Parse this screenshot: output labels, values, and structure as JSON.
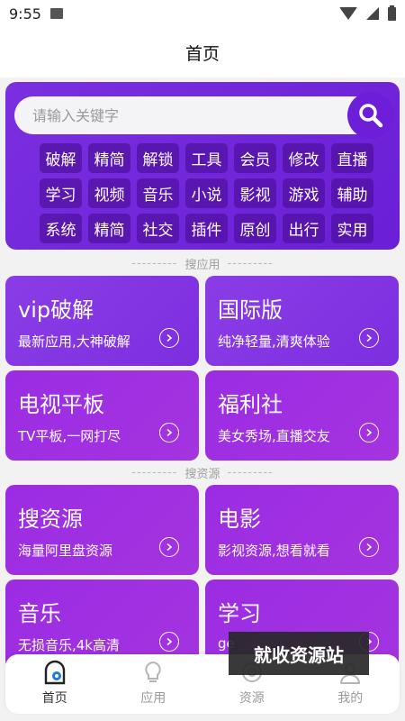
{
  "status": {
    "time": "9:55"
  },
  "header": {
    "title": "首页"
  },
  "search": {
    "placeholder": "请输入关键字"
  },
  "tags": [
    "破解",
    "精简",
    "解锁",
    "工具",
    "会员",
    "修改",
    "直播",
    "学习",
    "视频",
    "音乐",
    "小说",
    "影视",
    "游戏",
    "辅助",
    "系统",
    "精简",
    "社交",
    "插件",
    "原创",
    "出行",
    "实用"
  ],
  "sections": {
    "apps": "搜应用",
    "resources": "搜资源",
    "dash": "---------"
  },
  "cards": [
    {
      "title": "vip破解",
      "sub": "最新应用,大神破解"
    },
    {
      "title": "国际版",
      "sub": "纯净轻量,清爽体验"
    },
    {
      "title": "电视平板",
      "sub": "TV平板,一网打尽"
    },
    {
      "title": "福利社",
      "sub": "美女秀场,直播交友"
    },
    {
      "title": "搜资源",
      "sub": "海量阿里盘资源"
    },
    {
      "title": "电影",
      "sub": "影视资源,想看就看"
    },
    {
      "title": "音乐",
      "sub": "无损音乐,4k高清"
    },
    {
      "title": "学习",
      "sub": "ge"
    }
  ],
  "watermark": "就收资源站",
  "nav": [
    "首页",
    "应用",
    "资源",
    "我的"
  ],
  "colors": {
    "accent": "#6c1ed8",
    "card": "#8a3de6",
    "card_pink": "#a434df"
  },
  "icons": {
    "search": "magnifier-icon",
    "arrow": "chevron-right-circle-icon",
    "home": "home-icon",
    "apps": "lightbulb-icon",
    "resources": "at-icon",
    "mine": "user-icon"
  }
}
